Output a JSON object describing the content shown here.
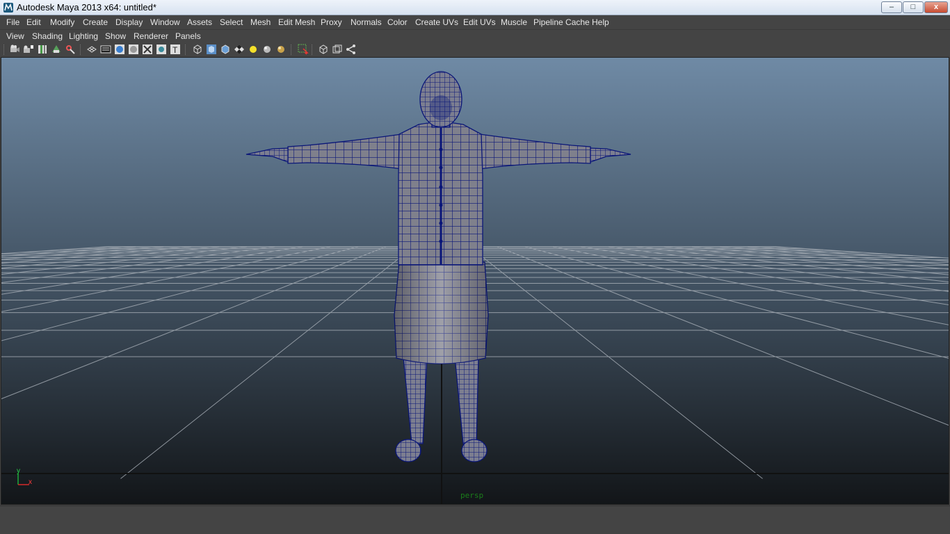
{
  "window": {
    "title": "Autodesk Maya 2013 x64: untitled*",
    "controls": {
      "minimize": "–",
      "maximize": "□",
      "close": "x"
    }
  },
  "menubar": {
    "items": [
      "File",
      "Edit",
      "Modify",
      "Create",
      "Display",
      "Window",
      "Assets",
      "Select",
      "Mesh",
      "Edit Mesh",
      "Proxy",
      "Normals",
      "Color",
      "Create UVs",
      "Edit UVs",
      "Muscle",
      "Pipeline Cache",
      "Help"
    ]
  },
  "panel_menu": {
    "items": [
      "View",
      "Shading",
      "Lighting",
      "Show",
      "Renderer",
      "Panels"
    ]
  },
  "toolbar": {
    "icons": [
      "select-camera-icon",
      "camera-attributes-icon",
      "bookmark-icon",
      "image-plane-icon",
      "film-gate-icon",
      "resolution-gate-icon",
      "wireframe-icon",
      "smooth-shade-icon",
      "default-material-icon",
      "xray-icon",
      "xray-joints-icon",
      "isolate-select-icon",
      "textured-icon",
      "wireframe-on-shaded-icon",
      "shaded-cube-icon",
      "flat-cube-icon",
      "checker-icon",
      "lights-icon",
      "shadows-icon",
      "high-quality-icon",
      "select-tool-icon",
      "grid-view-icon",
      "two-panes-icon",
      "share-icon"
    ]
  },
  "viewport": {
    "camera": "persp",
    "axis": {
      "y": "y",
      "x": "x"
    },
    "colors": {
      "bg_top": "#6f8aa5",
      "bg_bottom": "#121518",
      "wire": "#0a1678",
      "mesh_fill": "#7f808c",
      "grid": "#a9b0b8"
    }
  }
}
